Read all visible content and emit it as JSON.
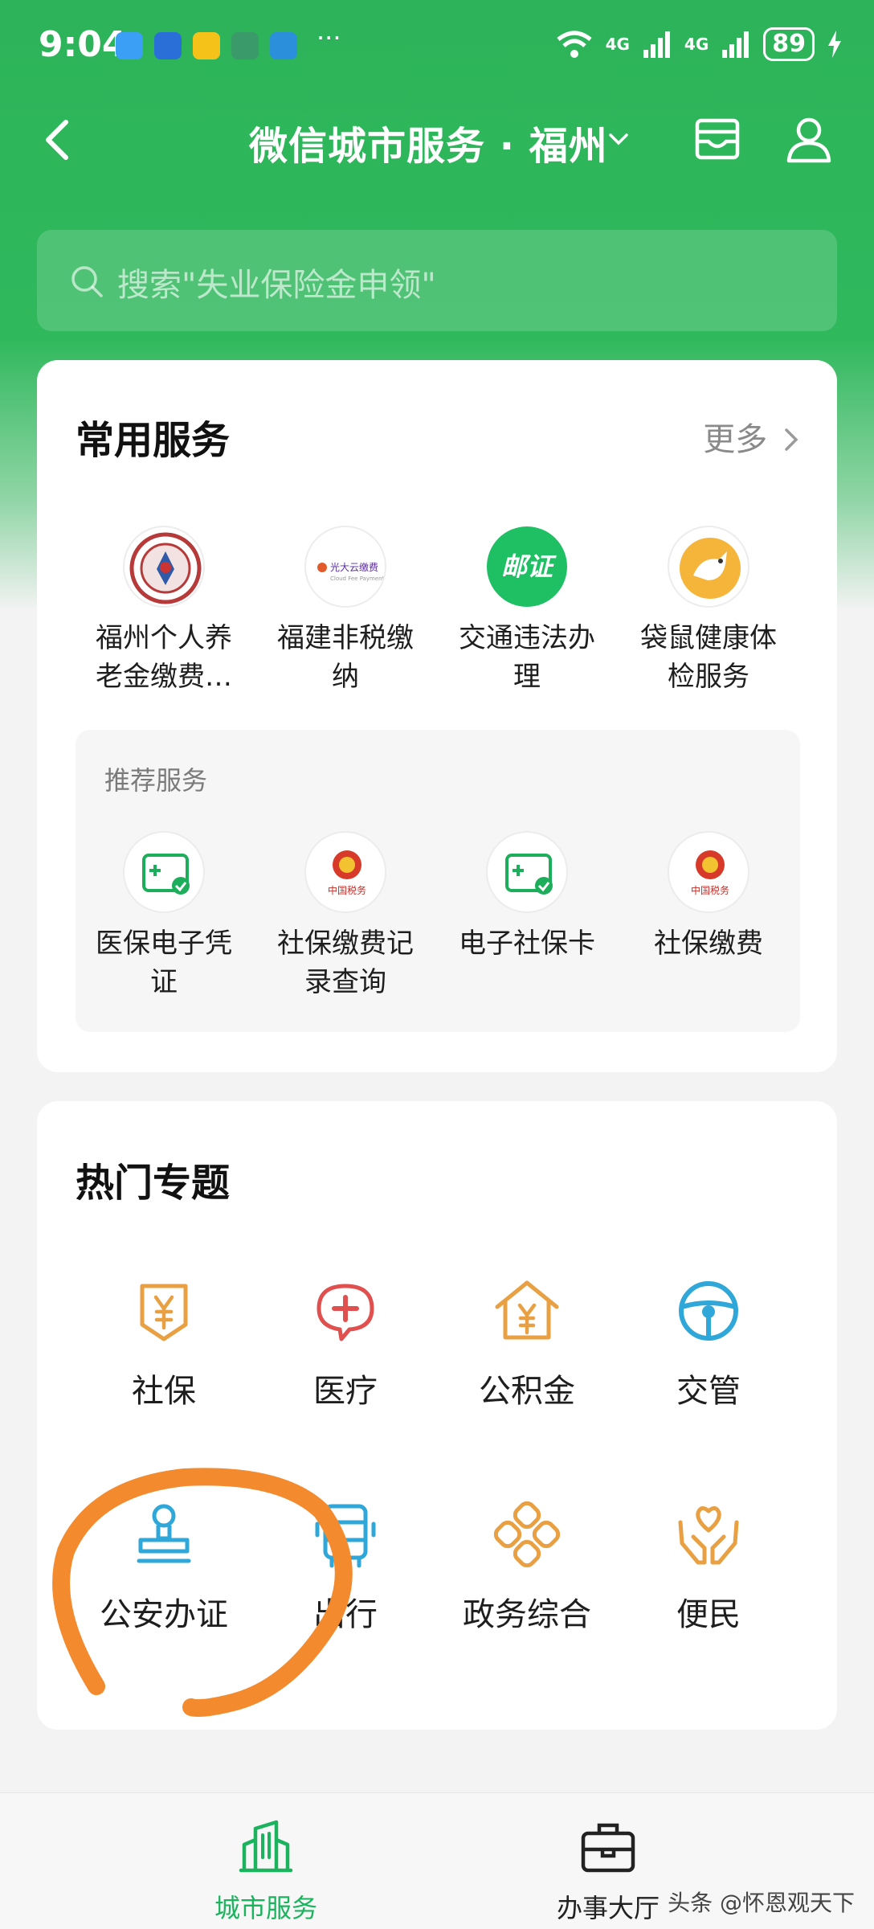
{
  "status_bar": {
    "time": "9:04",
    "more": "···",
    "signal_1": "4G",
    "signal_2": "4G",
    "battery": "89"
  },
  "header": {
    "title": "微信城市服务 · 福州"
  },
  "search": {
    "placeholder": "搜索\"失业保险金申领\""
  },
  "common_services": {
    "title": "常用服务",
    "more": "更多",
    "items": [
      {
        "label_line1": "福州个人养",
        "label_line2": "老金缴费…",
        "icon": "social-security-seal"
      },
      {
        "label_line1": "福建非税缴",
        "label_line2": "纳",
        "icon": "cloud-fee-payment-logo"
      },
      {
        "label_line1": "交通违法办",
        "label_line2": "理",
        "icon": "postal-license-logo"
      },
      {
        "label_line1": "袋鼠健康体",
        "label_line2": "检服务",
        "icon": "kangaroo-logo"
      }
    ],
    "recommended": {
      "title": "推荐服务",
      "items": [
        {
          "label_line1": "医保电子凭",
          "label_line2": "证",
          "icon": "medical-card-icon"
        },
        {
          "label_line1": "社保缴费记",
          "label_line2": "录查询",
          "icon": "tax-emblem"
        },
        {
          "label_line1": "电子社保卡",
          "label_line2": "",
          "icon": "medical-card-icon"
        },
        {
          "label_line1": "社保缴费",
          "label_line2": "",
          "icon": "tax-emblem"
        }
      ]
    }
  },
  "hot_topics": {
    "title": "热门专题",
    "items": [
      {
        "label": "社保",
        "icon": "yuan-shield-icon"
      },
      {
        "label": "医疗",
        "icon": "medical-cross-icon"
      },
      {
        "label": "公积金",
        "icon": "house-yuan-icon"
      },
      {
        "label": "交管",
        "icon": "steering-wheel-icon"
      },
      {
        "label": "公安办证",
        "icon": "stamp-icon"
      },
      {
        "label": "出行",
        "icon": "bus-icon"
      },
      {
        "label": "政务综合",
        "icon": "knot-icon"
      },
      {
        "label": "便民",
        "icon": "hands-heart-icon"
      }
    ]
  },
  "bottom_nav": {
    "city_services": "城市服务",
    "service_hall": "办事大厅"
  },
  "watermark": "头条 @怀恩观天下",
  "colors": {
    "brand_green": "#2db45a",
    "topic_orange": "#e8a043",
    "topic_red": "#e0504f",
    "topic_blue": "#2fa7d8",
    "annotation_orange": "#f38a2e"
  },
  "logo_texts": {
    "cloud_fee_cn": "光大云缴费",
    "cloud_fee_en": "Cloud Fee Payment",
    "postal_license": "邮证",
    "tax_emblem": "中国税务"
  }
}
